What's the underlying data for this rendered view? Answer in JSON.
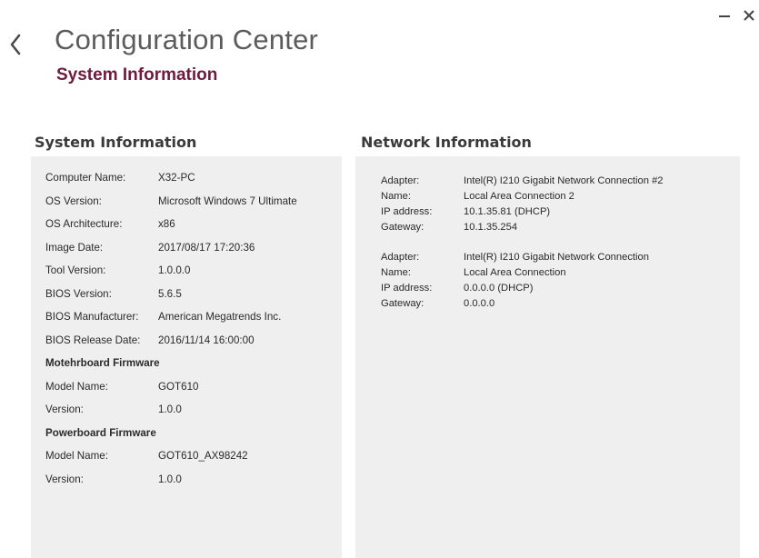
{
  "header": {
    "title": "Configuration Center",
    "subtitle": "System Information"
  },
  "window_controls": {
    "minimize_icon": "minus-icon",
    "close_icon": "close-x-icon"
  },
  "system_info": {
    "heading": "System Information",
    "rows": [
      {
        "key": "Computer Name:",
        "value": "X32-PC"
      },
      {
        "key": "OS Version:",
        "value": "Microsoft Windows 7 Ultimate"
      },
      {
        "key": "OS Architecture:",
        "value": "x86"
      },
      {
        "key": "Image Date:",
        "value": "2017/08/17 17:20:36"
      },
      {
        "key": "Tool Version:",
        "value": "1.0.0.0"
      },
      {
        "key": "BIOS Version:",
        "value": "5.6.5"
      },
      {
        "key": "BIOS Manufacturer:",
        "value": "American Megatrends Inc."
      },
      {
        "key": "BIOS Release Date:",
        "value": "2016/11/14 16:00:00"
      }
    ],
    "motherboard_heading": "Motehrboard Firmware",
    "motherboard_rows": [
      {
        "key": "Model Name:",
        "value": "GOT610"
      },
      {
        "key": "Version:",
        "value": "1.0.0"
      }
    ],
    "powerboard_heading": "Powerboard Firmware",
    "powerboard_rows": [
      {
        "key": "Model Name:",
        "value": "GOT610_AX98242"
      },
      {
        "key": "Version:",
        "value": "1.0.0"
      }
    ]
  },
  "network_info": {
    "heading": "Network Information",
    "adapters": [
      {
        "adapter_label": "Adapter:",
        "adapter": "Intel(R) I210 Gigabit Network Connection #2",
        "name_label": "Name:",
        "name": "Local Area Connection 2",
        "ip_label": "IP address:",
        "ip": "10.1.35.81 (DHCP)",
        "gateway_label": "Gateway:",
        "gateway": "10.1.35.254"
      },
      {
        "adapter_label": "Adapter:",
        "adapter": "Intel(R) I210 Gigabit Network Connection",
        "name_label": "Name:",
        "name": "Local Area Connection",
        "ip_label": "IP address:",
        "ip": "0.0.0.0 (DHCP)",
        "gateway_label": "Gateway:",
        "gateway": "0.0.0.0"
      }
    ]
  },
  "colors": {
    "subtitle": "#6e1b3c",
    "panel_bg": "#efefef",
    "title": "#5c5c5c"
  }
}
